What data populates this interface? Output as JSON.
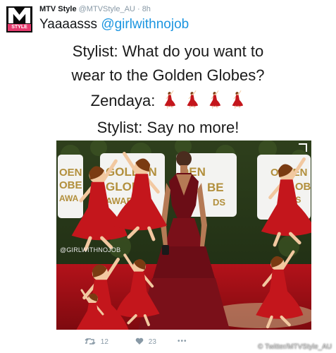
{
  "tweet": {
    "avatar_label": "STYLE",
    "author_name": "MTV Style",
    "author_handle": "@MTVStyle_AU",
    "separator": "·",
    "time": "8h",
    "text_prefix": "Yaaaasss ",
    "mention": "@girlwithnojob"
  },
  "meme": {
    "line1": "Stylist: What do you want to",
    "line2": "wear to the Golden Globes?",
    "line3_prefix": "Zendaya:",
    "line4": "Stylist: Say no more!",
    "emoji_name": "dancer-emoji",
    "emoji_count": 4,
    "backdrop_text": [
      "GOLDEN",
      "GLOBE",
      "AWARDS",
      "OEN",
      "OBE",
      "AWA",
      "DEN",
      "BE",
      "DS",
      "OLDEN",
      "GLOBE",
      "RDS"
    ],
    "watermark": "@GIRLWITHNOJOB"
  },
  "actions": {
    "retweet_count": "12",
    "like_count": "23",
    "more_label": "•••"
  },
  "credit": "© Twitter/MTVStyle_AU",
  "colors": {
    "mention_blue": "#1b95e0",
    "meta_gray": "#8899a6",
    "dress_red": "#c4161c",
    "gown_burgundy": "#6b0d16",
    "carpet_red": "#a10d12",
    "retweet_green": "#8899a6"
  }
}
